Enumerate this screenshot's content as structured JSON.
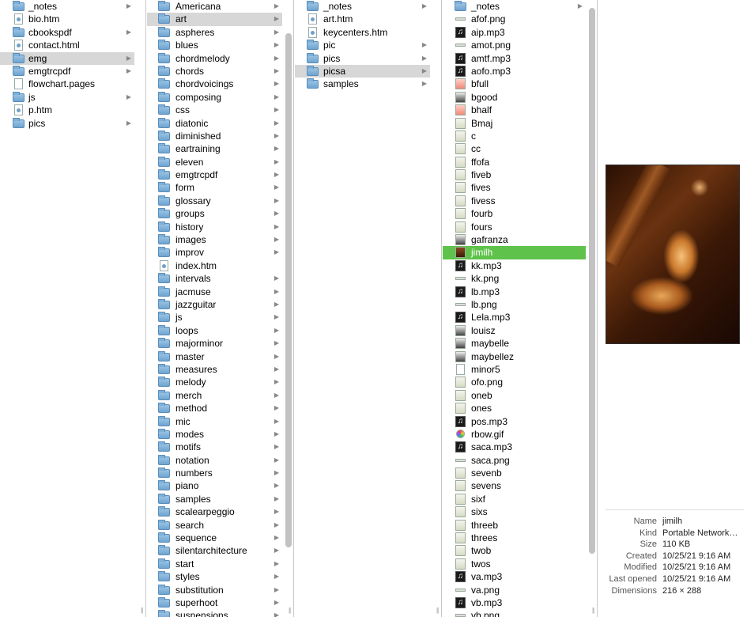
{
  "columns": [
    {
      "items": [
        {
          "label": "_notes",
          "icon": "folder",
          "chev": true
        },
        {
          "label": "bio.htm",
          "icon": "doc-blue",
          "chev": false
        },
        {
          "label": "cbookspdf",
          "icon": "folder",
          "chev": true
        },
        {
          "label": "contact.html",
          "icon": "doc-blue",
          "chev": false
        },
        {
          "label": "emg",
          "icon": "folder",
          "chev": true,
          "state": "selected-gray"
        },
        {
          "label": "emgtrcpdf",
          "icon": "folder",
          "chev": true
        },
        {
          "label": "flowchart.pages",
          "icon": "doc",
          "chev": false
        },
        {
          "label": "js",
          "icon": "folder",
          "chev": true
        },
        {
          "label": "p.htm",
          "icon": "doc-blue",
          "chev": false
        },
        {
          "label": "pics",
          "icon": "folder",
          "chev": true
        }
      ]
    },
    {
      "items": [
        {
          "label": "Americana",
          "icon": "folder",
          "chev": true
        },
        {
          "label": "art",
          "icon": "folder",
          "chev": true,
          "state": "selected-gray"
        },
        {
          "label": "aspheres",
          "icon": "folder",
          "chev": true
        },
        {
          "label": "blues",
          "icon": "folder",
          "chev": true
        },
        {
          "label": "chordmelody",
          "icon": "folder",
          "chev": true
        },
        {
          "label": "chords",
          "icon": "folder",
          "chev": true
        },
        {
          "label": "chordvoicings",
          "icon": "folder",
          "chev": true
        },
        {
          "label": "composing",
          "icon": "folder",
          "chev": true
        },
        {
          "label": "css",
          "icon": "folder",
          "chev": true
        },
        {
          "label": "diatonic",
          "icon": "folder",
          "chev": true
        },
        {
          "label": "diminished",
          "icon": "folder",
          "chev": true
        },
        {
          "label": "eartraining",
          "icon": "folder",
          "chev": true
        },
        {
          "label": "eleven",
          "icon": "folder",
          "chev": true
        },
        {
          "label": "emgtrcpdf",
          "icon": "folder",
          "chev": true
        },
        {
          "label": "form",
          "icon": "folder",
          "chev": true
        },
        {
          "label": "glossary",
          "icon": "folder",
          "chev": true
        },
        {
          "label": "groups",
          "icon": "folder",
          "chev": true
        },
        {
          "label": "history",
          "icon": "folder",
          "chev": true
        },
        {
          "label": "images",
          "icon": "folder",
          "chev": true
        },
        {
          "label": "improv",
          "icon": "folder",
          "chev": true
        },
        {
          "label": "index.htm",
          "icon": "doc-blue",
          "chev": false
        },
        {
          "label": "intervals",
          "icon": "folder",
          "chev": true
        },
        {
          "label": "jacmuse",
          "icon": "folder",
          "chev": true
        },
        {
          "label": "jazzguitar",
          "icon": "folder",
          "chev": true
        },
        {
          "label": "js",
          "icon": "folder",
          "chev": true
        },
        {
          "label": "loops",
          "icon": "folder",
          "chev": true
        },
        {
          "label": "majorminor",
          "icon": "folder",
          "chev": true
        },
        {
          "label": "master",
          "icon": "folder",
          "chev": true
        },
        {
          "label": "measures",
          "icon": "folder",
          "chev": true
        },
        {
          "label": "melody",
          "icon": "folder",
          "chev": true
        },
        {
          "label": "merch",
          "icon": "folder",
          "chev": true
        },
        {
          "label": "method",
          "icon": "folder",
          "chev": true
        },
        {
          "label": "mic",
          "icon": "folder",
          "chev": true
        },
        {
          "label": "modes",
          "icon": "folder",
          "chev": true
        },
        {
          "label": "motifs",
          "icon": "folder",
          "chev": true
        },
        {
          "label": "notation",
          "icon": "folder",
          "chev": true
        },
        {
          "label": "numbers",
          "icon": "folder",
          "chev": true
        },
        {
          "label": "piano",
          "icon": "folder",
          "chev": true
        },
        {
          "label": "samples",
          "icon": "folder",
          "chev": true
        },
        {
          "label": "scalearpeggio",
          "icon": "folder",
          "chev": true
        },
        {
          "label": "search",
          "icon": "folder",
          "chev": true
        },
        {
          "label": "sequence",
          "icon": "folder",
          "chev": true
        },
        {
          "label": "silentarchitecture",
          "icon": "folder",
          "chev": true
        },
        {
          "label": "start",
          "icon": "folder",
          "chev": true
        },
        {
          "label": "styles",
          "icon": "folder",
          "chev": true
        },
        {
          "label": "substitution",
          "icon": "folder",
          "chev": true
        },
        {
          "label": "superhoot",
          "icon": "folder",
          "chev": true
        },
        {
          "label": "suspensions",
          "icon": "folder",
          "chev": true
        }
      ]
    },
    {
      "items": [
        {
          "label": "_notes",
          "icon": "folder",
          "chev": true
        },
        {
          "label": "art.htm",
          "icon": "doc-blue",
          "chev": false
        },
        {
          "label": "keycenters.htm",
          "icon": "doc-blue",
          "chev": false
        },
        {
          "label": "pic",
          "icon": "folder",
          "chev": true
        },
        {
          "label": "pics",
          "icon": "folder",
          "chev": true
        },
        {
          "label": "picsa",
          "icon": "folder",
          "chev": true,
          "state": "selected-gray"
        },
        {
          "label": "samples",
          "icon": "folder",
          "chev": true
        }
      ]
    },
    {
      "items": [
        {
          "label": "_notes",
          "icon": "folder",
          "chev": true
        },
        {
          "label": "afof.png",
          "icon": "img-thin",
          "chev": false
        },
        {
          "label": "aip.mp3",
          "icon": "mp3",
          "chev": false
        },
        {
          "label": "amot.png",
          "icon": "img-thin",
          "chev": false
        },
        {
          "label": "amtf.mp3",
          "icon": "mp3",
          "chev": false
        },
        {
          "label": "aofo.mp3",
          "icon": "mp3",
          "chev": false
        },
        {
          "label": "bfull",
          "icon": "img-red",
          "chev": false
        },
        {
          "label": "bgood",
          "icon": "img-bw",
          "chev": false
        },
        {
          "label": "bhalf",
          "icon": "img-red",
          "chev": false
        },
        {
          "label": "Bmaj",
          "icon": "img",
          "chev": false
        },
        {
          "label": "c",
          "icon": "img",
          "chev": false
        },
        {
          "label": "cc",
          "icon": "img",
          "chev": false
        },
        {
          "label": "ffofa",
          "icon": "img",
          "chev": false
        },
        {
          "label": "fiveb",
          "icon": "img",
          "chev": false
        },
        {
          "label": "fives",
          "icon": "img",
          "chev": false
        },
        {
          "label": "fivess",
          "icon": "img",
          "chev": false
        },
        {
          "label": "fourb",
          "icon": "img",
          "chev": false
        },
        {
          "label": "fours",
          "icon": "img",
          "chev": false
        },
        {
          "label": "gafranza",
          "icon": "img-bw",
          "chev": false
        },
        {
          "label": "jimilh",
          "icon": "img-dark",
          "chev": false,
          "state": "selected-green"
        },
        {
          "label": "kk.mp3",
          "icon": "mp3",
          "chev": false
        },
        {
          "label": "kk.png",
          "icon": "img-thin",
          "chev": false
        },
        {
          "label": "lb.mp3",
          "icon": "mp3",
          "chev": false
        },
        {
          "label": "lb.png",
          "icon": "img-thin",
          "chev": false
        },
        {
          "label": "Lela.mp3",
          "icon": "mp3",
          "chev": false
        },
        {
          "label": "louisz",
          "icon": "img-bw",
          "chev": false
        },
        {
          "label": "maybelle",
          "icon": "img-bw",
          "chev": false
        },
        {
          "label": "maybellez",
          "icon": "img-bw",
          "chev": false
        },
        {
          "label": "minor5",
          "icon": "doc",
          "chev": false
        },
        {
          "label": "ofo.png",
          "icon": "img",
          "chev": false
        },
        {
          "label": "oneb",
          "icon": "img",
          "chev": false
        },
        {
          "label": "ones",
          "icon": "img",
          "chev": false
        },
        {
          "label": "pos.mp3",
          "icon": "mp3",
          "chev": false
        },
        {
          "label": "rbow.gif",
          "icon": "img-rainbow",
          "chev": false
        },
        {
          "label": "saca.mp3",
          "icon": "mp3",
          "chev": false
        },
        {
          "label": "saca.png",
          "icon": "img-thin",
          "chev": false
        },
        {
          "label": "sevenb",
          "icon": "img",
          "chev": false
        },
        {
          "label": "sevens",
          "icon": "img",
          "chev": false
        },
        {
          "label": "sixf",
          "icon": "img",
          "chev": false
        },
        {
          "label": "sixs",
          "icon": "img",
          "chev": false
        },
        {
          "label": "threeb",
          "icon": "img",
          "chev": false
        },
        {
          "label": "threes",
          "icon": "img",
          "chev": false
        },
        {
          "label": "twob",
          "icon": "img",
          "chev": false
        },
        {
          "label": "twos",
          "icon": "img",
          "chev": false
        },
        {
          "label": "va.mp3",
          "icon": "mp3",
          "chev": false
        },
        {
          "label": "va.png",
          "icon": "img-thin",
          "chev": false
        },
        {
          "label": "vb.mp3",
          "icon": "mp3",
          "chev": false
        },
        {
          "label": "vb.png",
          "icon": "img-thin",
          "chev": false
        }
      ]
    }
  ],
  "info": [
    {
      "key": "Name",
      "value": "jimilh"
    },
    {
      "key": "Kind",
      "value": "Portable Network…"
    },
    {
      "key": "Size",
      "value": "110 KB"
    },
    {
      "key": "Created",
      "value": "10/25/21 9:16 AM"
    },
    {
      "key": "Modified",
      "value": "10/25/21 9:16 AM"
    },
    {
      "key": "Last opened",
      "value": "10/25/21 9:16 AM"
    },
    {
      "key": "Dimensions",
      "value": "216 × 288"
    }
  ],
  "colors": {
    "selection_active": "#5fc24a",
    "selection_inactive": "#d7d7d7",
    "folder": "#7fb0d8"
  }
}
